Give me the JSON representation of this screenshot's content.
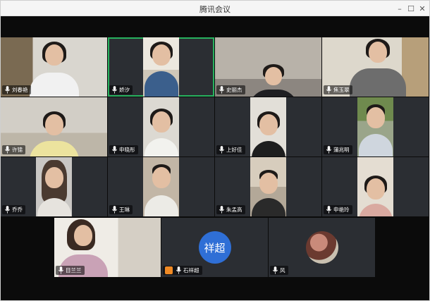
{
  "window": {
    "title": "腾讯会议",
    "minimize_glyph": "–",
    "maximize_glyph": "☐",
    "close_glyph": "✕"
  },
  "participants": [
    {
      "name": "刘春艳",
      "avatar_text": ""
    },
    {
      "name": "娇汐",
      "avatar_text": ""
    },
    {
      "name": "史丽杰",
      "avatar_text": ""
    },
    {
      "name": "焦玉翠",
      "avatar_text": ""
    },
    {
      "name": "许锦",
      "avatar_text": ""
    },
    {
      "name": "申晓彤",
      "avatar_text": ""
    },
    {
      "name": "上好佳",
      "avatar_text": ""
    },
    {
      "name": "蒲兆明",
      "avatar_text": ""
    },
    {
      "name": "乔乔",
      "avatar_text": ""
    },
    {
      "name": "王琳",
      "avatar_text": ""
    },
    {
      "name": "朱孟高",
      "avatar_text": ""
    },
    {
      "name": "申艳玲",
      "avatar_text": ""
    },
    {
      "name": "目兰兰",
      "avatar_text": ""
    },
    {
      "name": "石祥超",
      "avatar_text": "祥超"
    },
    {
      "name": "风",
      "avatar_text": ""
    }
  ],
  "colors": {
    "active_speaker_border": "#27b15e",
    "tile_bg": "#2b2e33",
    "avatar_blue": "#2f6fd6",
    "share_badge": "#f08a24"
  }
}
